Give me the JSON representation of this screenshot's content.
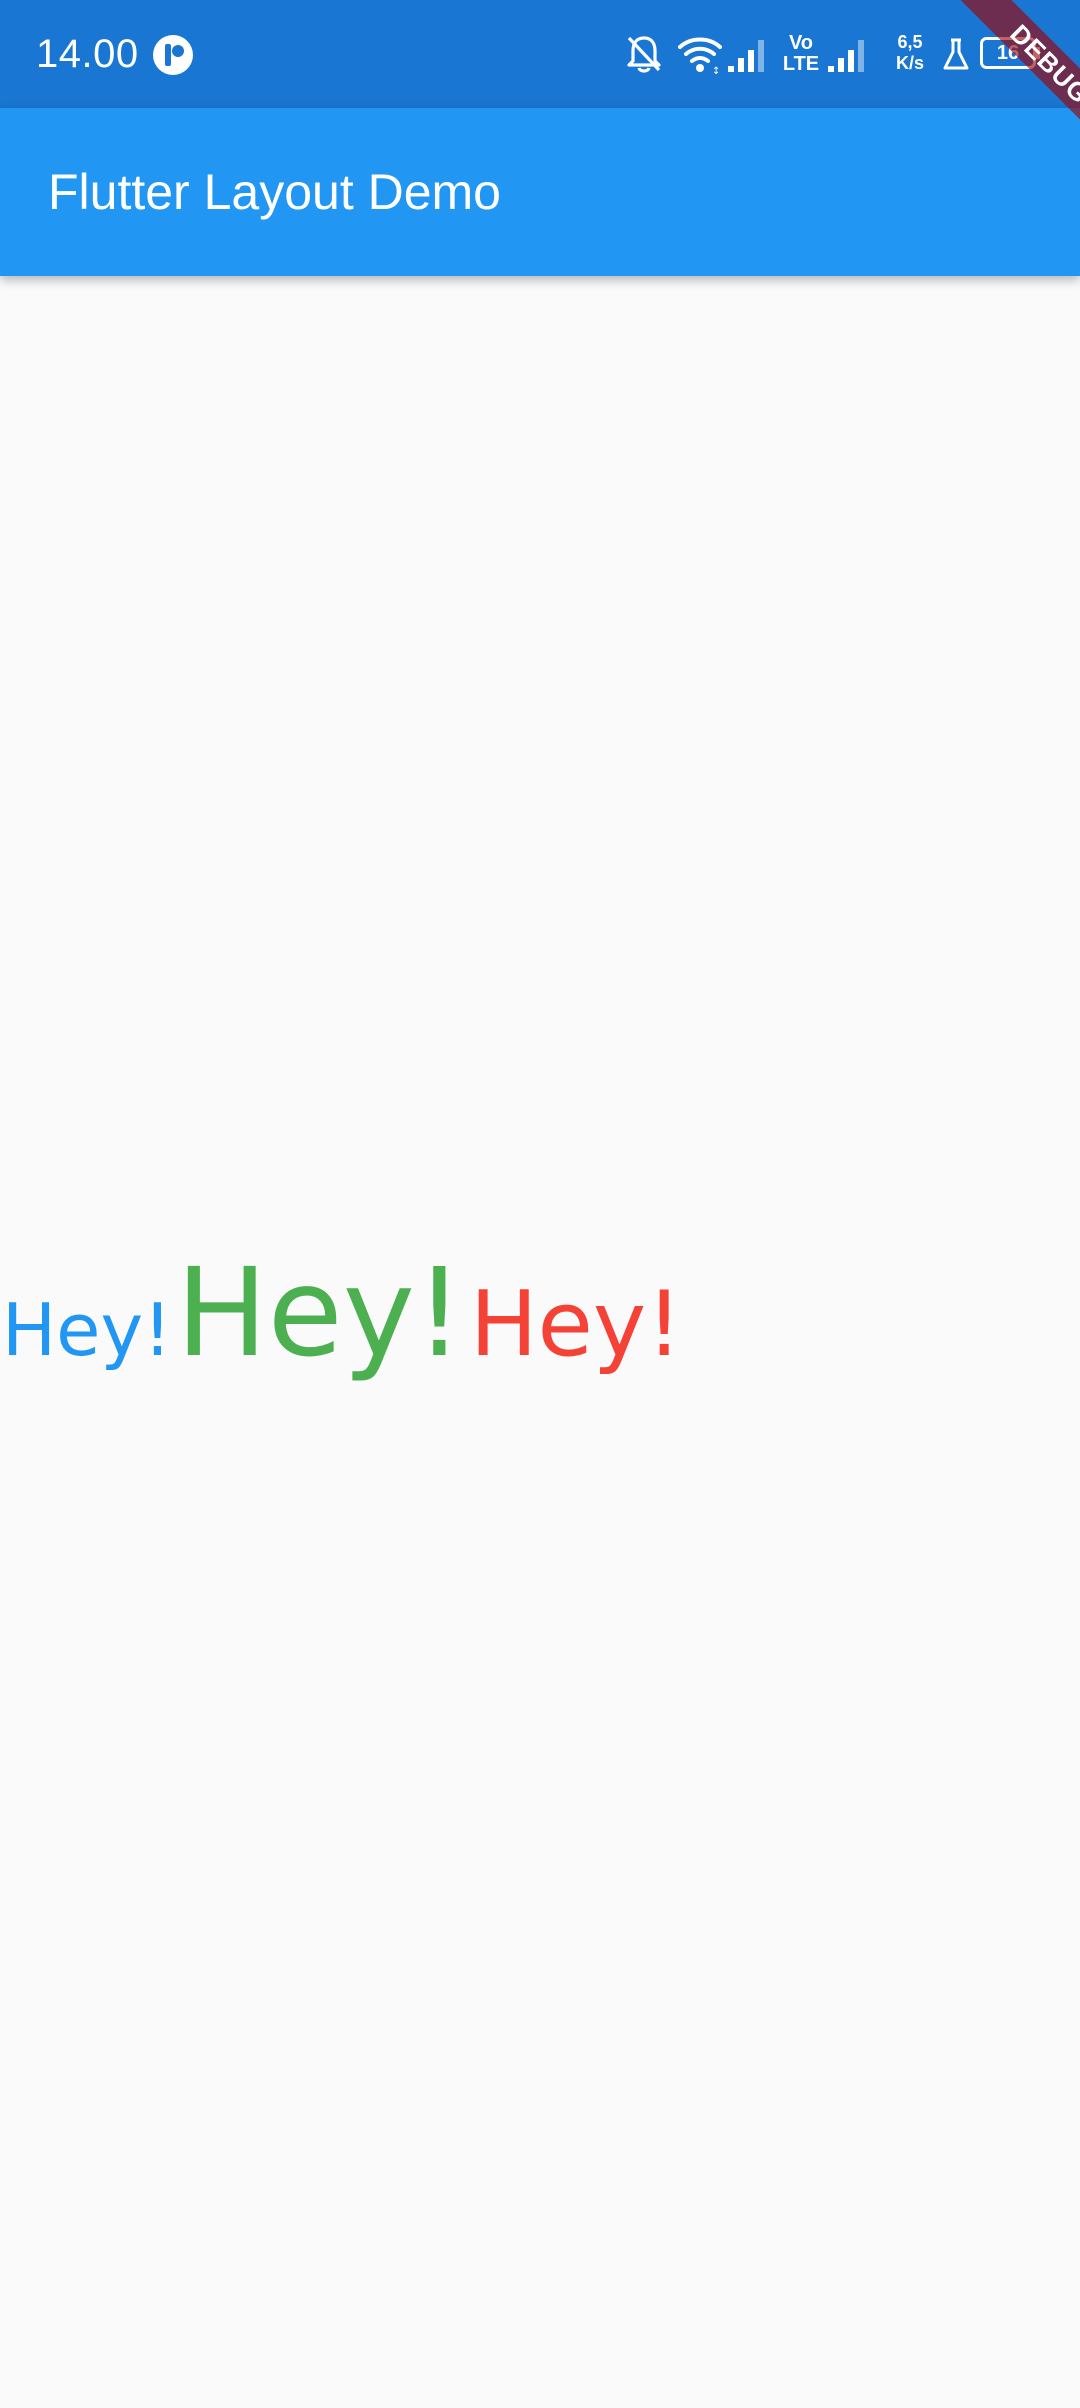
{
  "status_bar": {
    "time": "14.00",
    "network_type_top": "Vo",
    "network_type_bottom": "LTE",
    "net_speed_value": "6,5",
    "net_speed_unit": "K/s",
    "battery_level": "16",
    "icons": [
      "notifications-off-icon",
      "wifi-icon",
      "signal-icon",
      "volte-icon",
      "signal-icon",
      "lab-icon",
      "battery-icon"
    ]
  },
  "app_bar": {
    "title": "Flutter Layout Demo"
  },
  "debug_banner": {
    "label": "DEBUG"
  },
  "body": {
    "texts": [
      {
        "label": "Hey!",
        "color": "#2196f3"
      },
      {
        "label": "Hey!",
        "color": "#4caf50"
      },
      {
        "label": "Hey!",
        "color": "#f44336"
      }
    ]
  },
  "colors": {
    "status_bar": "#1976d2",
    "app_bar": "#2196f3",
    "background": "#fafafa",
    "debug_banner": "#a00000"
  }
}
